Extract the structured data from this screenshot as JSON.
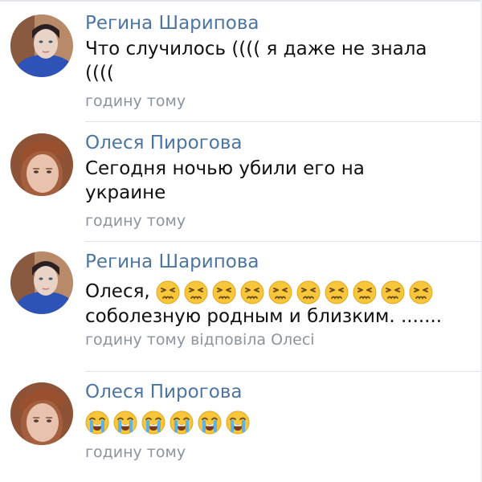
{
  "comments": [
    {
      "author": "Регина Шарипова",
      "text_line1": "Что случилось (((( я даже не знала",
      "text_line2": "((((",
      "meta": "годину тому",
      "avatar": "avatar-woman-blue-hoodie"
    },
    {
      "author": "Олеся Пирогова",
      "text_line1": "Сегодня ночью убили его на",
      "text_line2": "украине",
      "meta": "годину тому",
      "avatar": "avatar-woman-red-hair"
    },
    {
      "author": "Регина Шарипова",
      "text_prefix": "Олеся,",
      "emoji_name": "persevering-face-emoji",
      "emoji_count": 10,
      "text_line2": "соболезную родным и близким. .......",
      "meta": "годину тому відповіла Олесі",
      "avatar": "avatar-woman-blue-hoodie"
    },
    {
      "author": "Олеся Пирогова",
      "emoji_name": "loudly-crying-face-emoji",
      "emoji_count": 6,
      "meta": "годину тому",
      "avatar": "avatar-woman-red-hair"
    }
  ],
  "colors": {
    "author": "#4c75a3",
    "text": "#111111",
    "meta": "#8c949e",
    "divider": "#e1e3e6"
  }
}
